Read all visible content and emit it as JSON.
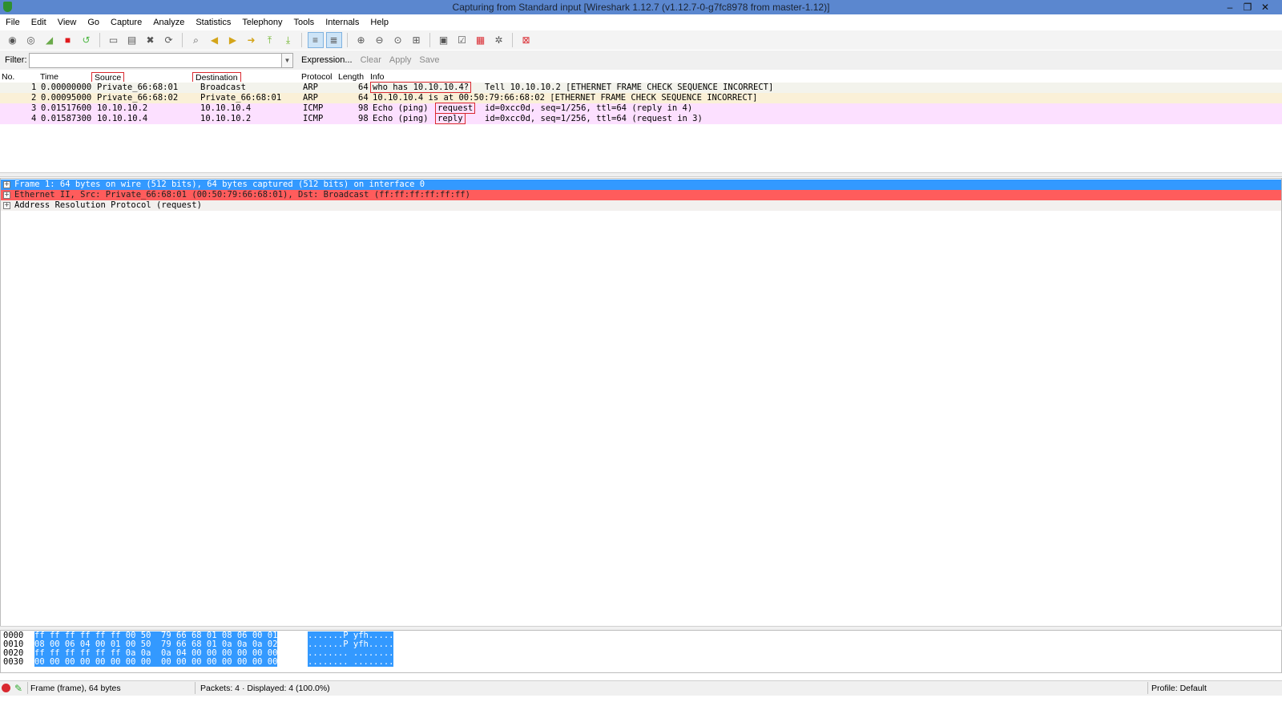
{
  "window": {
    "title": "Capturing from Standard input   [Wireshark 1.12.7  (v1.12.7-0-g7fc8978 from master-1.12)]",
    "controls": [
      "‒",
      "❐",
      "✕"
    ]
  },
  "menu": [
    "File",
    "Edit",
    "View",
    "Go",
    "Capture",
    "Analyze",
    "Statistics",
    "Telephony",
    "Tools",
    "Internals",
    "Help"
  ],
  "toolbar_icons": [
    "interfaces-icon",
    "options-icon",
    "start-capture-icon",
    "stop-capture-icon",
    "restart-capture-icon",
    "open-icon",
    "save-icon",
    "close-icon",
    "reload-icon",
    "find-icon",
    "back-icon",
    "forward-icon",
    "goto-icon",
    "first-packet-icon",
    "last-packet-icon",
    "colorize-icon",
    "autoscroll-icon",
    "zoom-in-icon",
    "zoom-out-icon",
    "normal-size-icon",
    "resize-columns-icon",
    "capture-filters-icon",
    "display-filters-icon",
    "coloring-rules-icon",
    "preferences-icon",
    "help-icon"
  ],
  "filter": {
    "label": "Filter:",
    "value": "",
    "expression": "Expression...",
    "clear": "Clear",
    "apply": "Apply",
    "save": "Save"
  },
  "columns": {
    "no": "No.",
    "time": "Time",
    "source": "Source",
    "destination": "Destination",
    "protocol": "Protocol",
    "length": "Length",
    "info": "Info"
  },
  "packets": [
    {
      "no": "1",
      "time": "0.00000000",
      "source": "Private_66:68:01",
      "destination": "Broadcast",
      "protocol": "ARP",
      "length": "64",
      "info_hl": "who has 10.10.10.4?",
      "info_rest": "Tell 10.10.10.2 [ETHERNET FRAME CHECK SEQUENCE INCORRECT]"
    },
    {
      "no": "2",
      "time": "0.00095000",
      "source": "Private_66:68:02",
      "destination": "Private_66:68:01",
      "protocol": "ARP",
      "length": "64",
      "info": "10.10.10.4 is at 00:50:79:66:68:02 [ETHERNET FRAME CHECK SEQUENCE INCORRECT]"
    },
    {
      "no": "3",
      "time": "0.01517600",
      "source": "10.10.10.2",
      "destination": "10.10.10.4",
      "protocol": "ICMP",
      "length": "98",
      "info_pre": "Echo (ping)",
      "info_hl": "request",
      "info_rest": "id=0xcc0d, seq=1/256, ttl=64 (reply in 4)"
    },
    {
      "no": "4",
      "time": "0.01587300",
      "source": "10.10.10.4",
      "destination": "10.10.10.2",
      "protocol": "ICMP",
      "length": "98",
      "info_pre": "Echo (ping)",
      "info_hl": "reply",
      "info_rest": "id=0xcc0d, seq=1/256, ttl=64 (request in 3)"
    }
  ],
  "details": [
    "Frame 1: 64 bytes on wire (512 bits), 64 bytes captured (512 bits) on interface 0",
    "Ethernet II, Src: Private_66:68:01 (00:50:79:66:68:01), Dst: Broadcast (ff:ff:ff:ff:ff:ff)",
    "Address Resolution Protocol (request)"
  ],
  "hex": [
    {
      "offset": "0000",
      "bytes": "ff ff ff ff ff ff 00 50  79 66 68 01 08 06 00 01",
      "ascii": ".......P yfh....."
    },
    {
      "offset": "0010",
      "bytes": "08 00 06 04 00 01 00 50  79 66 68 01 0a 0a 0a 02",
      "ascii": ".......P yfh....."
    },
    {
      "offset": "0020",
      "bytes": "ff ff ff ff ff ff 0a 0a  0a 04 00 00 00 00 00 00",
      "ascii": "........ ........"
    },
    {
      "offset": "0030",
      "bytes": "00 00 00 00 00 00 00 00  00 00 00 00 00 00 00 00",
      "ascii": "........ ........"
    }
  ],
  "status": {
    "frame": "Frame (frame), 64 bytes",
    "packets": "Packets: 4 · Displayed: 4 (100.0%)",
    "profile": "Profile: Default"
  }
}
